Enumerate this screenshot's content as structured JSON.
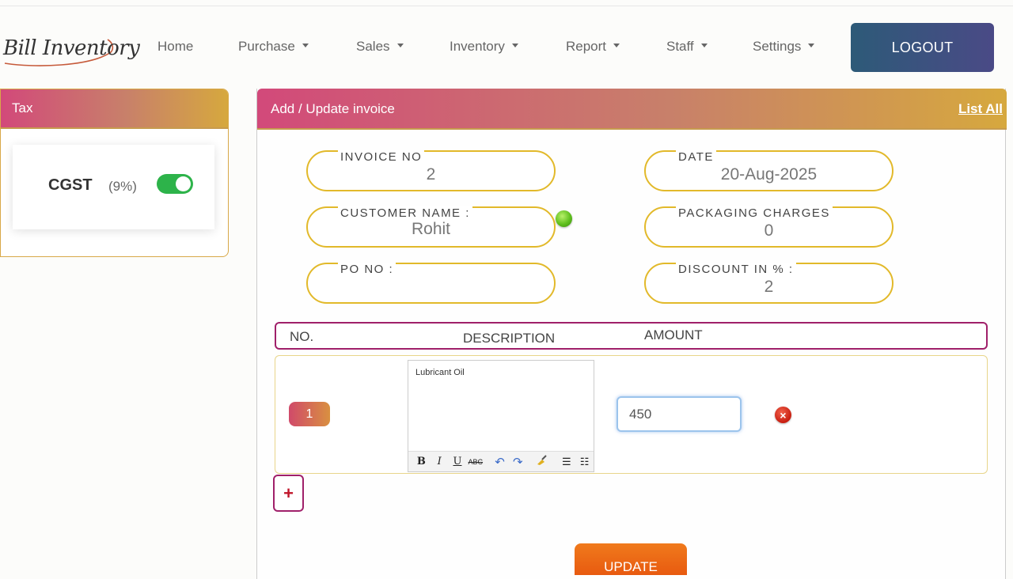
{
  "brand": {
    "name": "Bill Inventory"
  },
  "nav": {
    "items": [
      {
        "label": "Home",
        "dropdown": false
      },
      {
        "label": "Purchase",
        "dropdown": true
      },
      {
        "label": "Sales",
        "dropdown": true
      },
      {
        "label": "Inventory",
        "dropdown": true
      },
      {
        "label": "Report",
        "dropdown": true
      },
      {
        "label": "Staff",
        "dropdown": true
      },
      {
        "label": "Settings",
        "dropdown": true
      }
    ],
    "logout_label": "LOGOUT"
  },
  "tax": {
    "title": "Tax",
    "entry": {
      "name": "CGST",
      "rate": "(9%)",
      "enabled": true
    }
  },
  "invoice": {
    "title": "Add / Update invoice",
    "list_all_label": "List All",
    "fields": {
      "invoice_no": {
        "label": "INVOICE NO",
        "value": "2"
      },
      "date": {
        "label": "DATE",
        "value": "20-Aug-2025"
      },
      "customer_name": {
        "label": "CUSTOMER NAME :",
        "value": "Rohit"
      },
      "packaging_charges": {
        "label": "PACKAGING CHARGES",
        "value": "0"
      },
      "po_no": {
        "label": "PO NO :",
        "value": ""
      },
      "discount": {
        "label": "DISCOUNT IN % :",
        "value": "2"
      }
    },
    "table": {
      "headers": {
        "no": "NO.",
        "description": "DESCRIPTION",
        "amount": "AMOUNT"
      },
      "rows": [
        {
          "no": "1",
          "description": "Lubricant Oil",
          "amount": "450"
        }
      ]
    },
    "editor_toolbar": [
      "B",
      "I",
      "U",
      "ABC",
      "undo",
      "redo",
      "clean",
      "bullet-list",
      "numbered-list"
    ],
    "add_row_label": "+",
    "update_label": "UPDATE"
  },
  "colors": {
    "header_gradient_start": "#d2497a",
    "header_gradient_end": "#d6a83e",
    "pill_border": "#e2b92a",
    "logout_bg": "#2d5a78",
    "table_border": "#a0206a",
    "toggle_on": "#2db34a"
  }
}
